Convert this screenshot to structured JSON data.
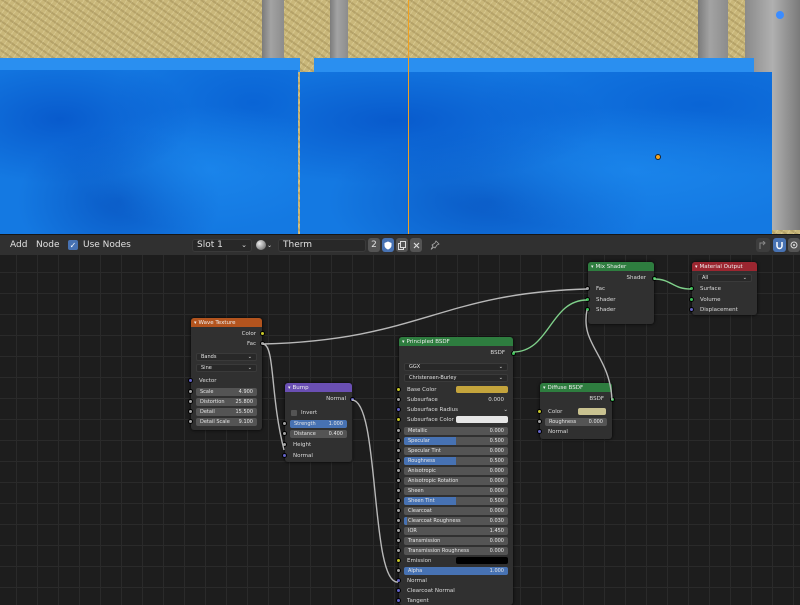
{
  "header": {
    "add": "Add",
    "node": "Node",
    "use_nodes": "Use Nodes",
    "slot": "Slot 1",
    "material_name": "Therm",
    "users": "2"
  },
  "nodes": {
    "wave": {
      "title": "Wave Texture",
      "out_color": "Color",
      "out_fac": "Fac",
      "type": "Bands",
      "profile": "Sine",
      "vector": "Vector",
      "fields": [
        {
          "label": "Scale",
          "value": "4.900"
        },
        {
          "label": "Distortion",
          "value": "25.800"
        },
        {
          "label": "Detail",
          "value": "15.500"
        },
        {
          "label": "Detail Scale",
          "value": "9.100"
        }
      ]
    },
    "bump": {
      "title": "Bump",
      "out_normal": "Normal",
      "invert": "Invert",
      "strength_label": "Strength",
      "strength_value": "1.000",
      "distance_label": "Distance",
      "distance_value": "0.400",
      "height": "Height",
      "normal": "Normal"
    },
    "principled": {
      "title": "Principled BSDF",
      "out": "BSDF",
      "distribution": "GGX",
      "subsurface_method": "Christensen-Burley",
      "base_color": "Base Color",
      "subsurface": "Subsurface",
      "subsurface_value": "0.000",
      "subsurface_radius": "Subsurface Radius",
      "subsurface_color": "Subsurface Color",
      "params": [
        {
          "label": "Metallic",
          "value": "0.000",
          "fill": 0
        },
        {
          "label": "Specular",
          "value": "0.500",
          "fill": 0.5
        },
        {
          "label": "Specular Tint",
          "value": "0.000",
          "fill": 0
        },
        {
          "label": "Roughness",
          "value": "0.500",
          "fill": 0.5
        },
        {
          "label": "Anisotropic",
          "value": "0.000",
          "fill": 0
        },
        {
          "label": "Anisotropic Rotation",
          "value": "0.000",
          "fill": 0
        },
        {
          "label": "Sheen",
          "value": "0.000",
          "fill": 0
        },
        {
          "label": "Sheen Tint",
          "value": "0.500",
          "fill": 0.5
        },
        {
          "label": "Clearcoat",
          "value": "0.000",
          "fill": 0
        },
        {
          "label": "Clearcoat Roughness",
          "value": "0.030",
          "fill": 0.03
        },
        {
          "label": "IOR",
          "value": "1.450",
          "fill": 0
        },
        {
          "label": "Transmission",
          "value": "0.000",
          "fill": 0
        },
        {
          "label": "Transmission Roughness",
          "value": "0.000",
          "fill": 0
        }
      ],
      "emission": "Emission",
      "alpha_label": "Alpha",
      "alpha_value": "1.000",
      "normal": "Normal",
      "clearcoat_normal": "Clearcoat Normal",
      "tangent": "Tangent"
    },
    "mix": {
      "title": "Mix Shader",
      "out": "Shader",
      "fac": "Fac",
      "shader1": "Shader",
      "shader2": "Shader"
    },
    "output": {
      "title": "Material Output",
      "target": "All",
      "surface": "Surface",
      "volume": "Volume",
      "displacement": "Displacement"
    },
    "diffuse": {
      "title": "Diffuse BSDF",
      "out": "BSDF",
      "color": "Color",
      "roughness_label": "Roughness",
      "roughness_value": "0.000",
      "normal": "Normal"
    }
  },
  "colors": {
    "texture_header": "#b3541e",
    "vector_header": "#6a4fb3",
    "shader_header": "#2e7d3f",
    "output_header": "#9b2630",
    "base_color": "#c4a43c",
    "diffuse_color": "#c9c290",
    "accent": "#4772b3"
  }
}
